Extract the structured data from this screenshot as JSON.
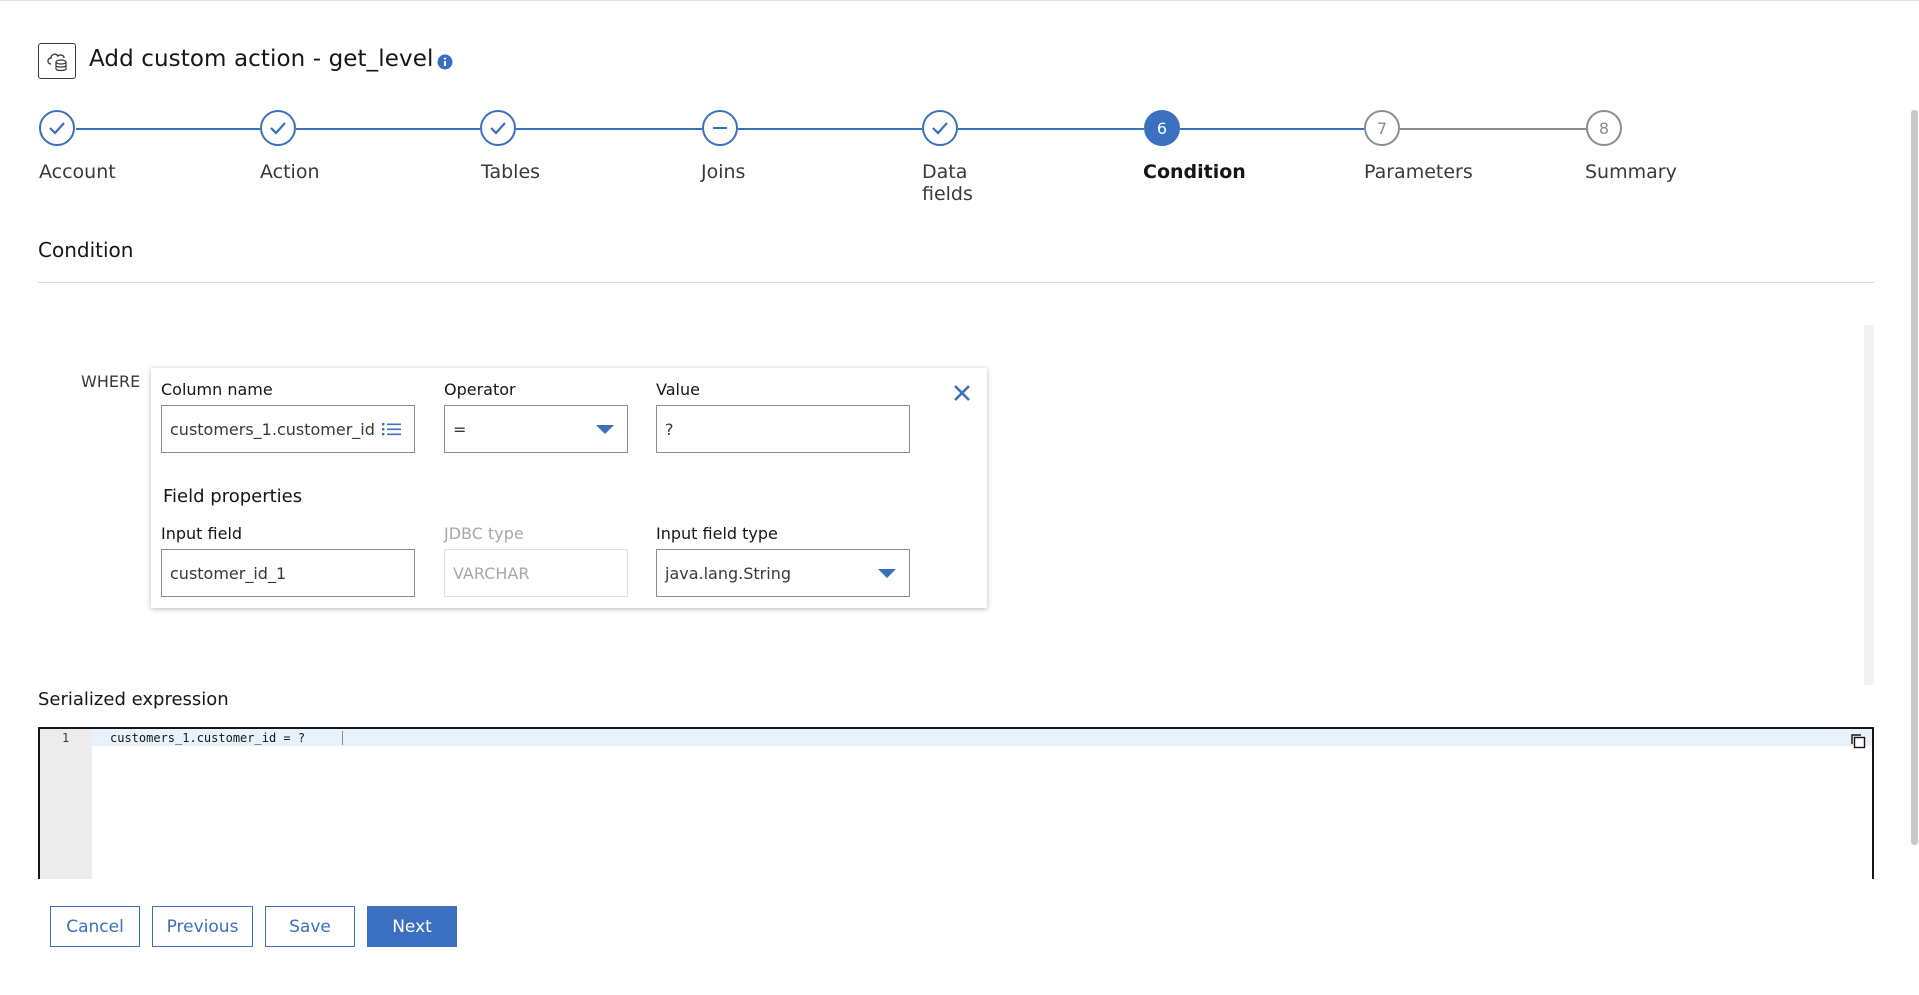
{
  "header": {
    "title": "Add custom action - get_level",
    "icon": "cloud-database-icon",
    "info_icon": "info-icon"
  },
  "progress": {
    "steps": [
      {
        "label": "Account",
        "state": "complete",
        "number": ""
      },
      {
        "label": "Action",
        "state": "complete",
        "number": ""
      },
      {
        "label": "Tables",
        "state": "complete",
        "number": ""
      },
      {
        "label": "Joins",
        "state": "skipped",
        "number": ""
      },
      {
        "label": "Data fields",
        "state": "complete",
        "number": ""
      },
      {
        "label": "Condition",
        "state": "current",
        "number": "6"
      },
      {
        "label": "Parameters",
        "state": "incomplete",
        "number": "7"
      },
      {
        "label": "Summary",
        "state": "incomplete",
        "number": "8"
      }
    ]
  },
  "section": {
    "title": "Condition"
  },
  "condition": {
    "where_label": "WHERE",
    "column_name": {
      "label": "Column name",
      "value": "customers_1.customer_id"
    },
    "operator": {
      "label": "Operator",
      "value": "="
    },
    "value_field": {
      "label": "Value",
      "value": "?"
    },
    "field_properties_title": "Field properties",
    "input_field": {
      "label": "Input field",
      "value": "customer_id_1"
    },
    "jdbc_type": {
      "label": "JDBC type",
      "value": "VARCHAR"
    },
    "input_field_type": {
      "label": "Input field type",
      "value": "java.lang.String"
    }
  },
  "serialized": {
    "label": "Serialized expression",
    "line_number": "1",
    "code": "customers_1.customer_id = ?"
  },
  "buttons": {
    "cancel": "Cancel",
    "previous": "Previous",
    "save": "Save",
    "next": "Next"
  },
  "colors": {
    "accent": "#3b6fc0",
    "incomplete": "#8d8d8d"
  }
}
